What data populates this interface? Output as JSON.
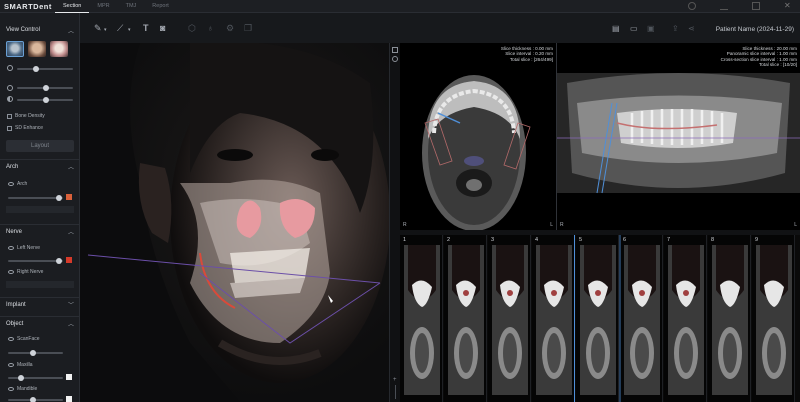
{
  "app": {
    "logo": "SMARTDent",
    "tabs": [
      "Section",
      "MPR",
      "TMJ",
      "Report"
    ],
    "active_tab": "Section"
  },
  "header": {
    "patient_name": "Patient Name (2024-11-29)"
  },
  "sidebar": {
    "view_control": {
      "title": "View Control"
    },
    "checkboxes": [
      {
        "label": "Bone Density",
        "checked": false
      },
      {
        "label": "SD Enhance",
        "checked": false
      }
    ],
    "layout_button": "Layout",
    "arch": {
      "title": "Arch",
      "item": "Arch",
      "color": "#d9603a"
    },
    "nerve": {
      "title": "Nerve",
      "left": "Left Nerve",
      "right": "Right Nerve",
      "left_color": "#d63a2a"
    },
    "implant": {
      "title": "Implant"
    },
    "object": {
      "title": "Object",
      "items": [
        {
          "label": "ScanFace"
        },
        {
          "label": "Maxilla",
          "color": "#f2f2f2"
        },
        {
          "label": "Mandible",
          "color": "#f2f2f2"
        }
      ]
    }
  },
  "axial_view": {
    "info": [
      "Slice thickness : 0.00 mm",
      "Slice interval : 0.20 mm",
      "Total slice : [264/499]"
    ],
    "labels": {
      "right": "R",
      "left": "L"
    }
  },
  "panoramic_view": {
    "info": [
      "Slice thickness : 20.00 mm",
      "Panoramic slice interval : 1.00 mm",
      "Cross-section slice interval : 1.00 mm",
      "Total slice : [10/20]"
    ],
    "labels": {
      "right": "R",
      "left": "L"
    }
  },
  "cross_sections": {
    "numbers": [
      "1",
      "2",
      "3",
      "4",
      "5",
      "6",
      "7",
      "8",
      "9"
    ]
  },
  "colors": {
    "accent": "#4f8fd8",
    "nerve": "#d63a2a",
    "arch": "#d9603a"
  }
}
